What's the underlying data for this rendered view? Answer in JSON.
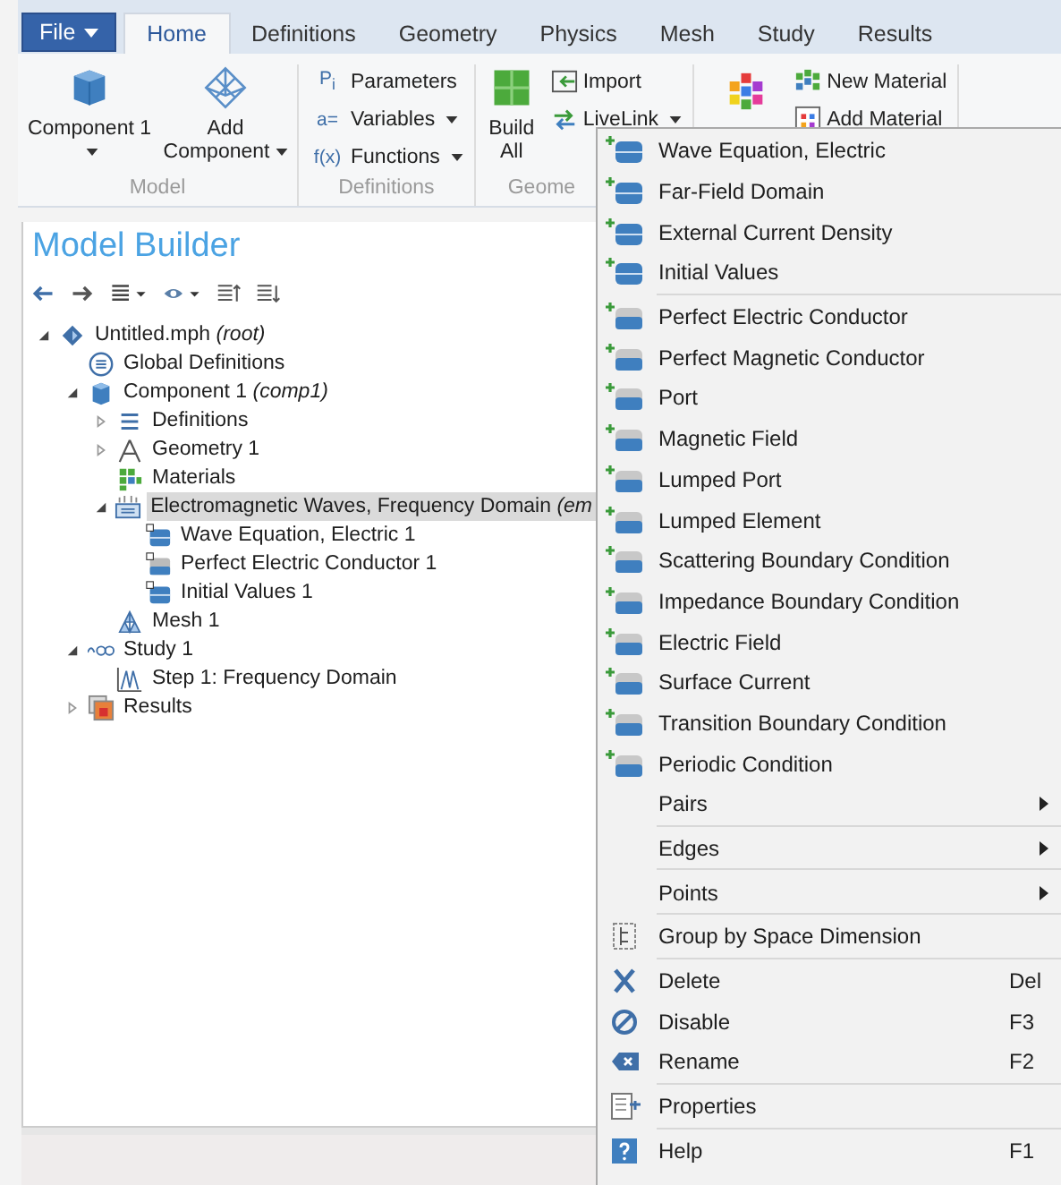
{
  "file_button": {
    "label": "File"
  },
  "tabs": [
    {
      "label": "Home",
      "selected": true
    },
    {
      "label": "Definitions",
      "selected": false
    },
    {
      "label": "Geometry",
      "selected": false
    },
    {
      "label": "Physics",
      "selected": false
    },
    {
      "label": "Mesh",
      "selected": false
    },
    {
      "label": "Study",
      "selected": false
    },
    {
      "label": "Results",
      "selected": false
    }
  ],
  "ribbon": {
    "groups": [
      {
        "label": "Model",
        "large_commands": [
          {
            "label": "Component 1",
            "dropdown": true
          },
          {
            "label": "Add Component",
            "dropdown": true
          }
        ]
      },
      {
        "label": "Definitions",
        "small_commands": [
          {
            "glyph": "P$_{i}$",
            "label": "Parameters",
            "dropdown": false
          },
          {
            "glyph": "a=",
            "label": "Variables",
            "dropdown": true
          },
          {
            "glyph": "f(x)",
            "label": "Functions",
            "dropdown": true
          }
        ]
      },
      {
        "label": "Geome",
        "large_commands": [
          {
            "label": "Build All",
            "dropdown": false
          }
        ],
        "small_commands": [
          {
            "label": "Import",
            "dropdown": false
          },
          {
            "label": "LiveLink",
            "dropdown": true
          }
        ]
      },
      {
        "small_commands": [
          {
            "label": "New Material",
            "dropdown": false
          },
          {
            "label": "Add Material",
            "dropdown": false
          }
        ]
      }
    ]
  },
  "model_builder": {
    "title": "Model Builder",
    "tree": [
      {
        "label": "Untitled.mph *(root)*",
        "kind": "root",
        "expanded": true,
        "selected": false,
        "children": [
          {
            "label": "Global Definitions",
            "kind": "global",
            "selected": false
          },
          {
            "label": "Component 1 *(comp1)*",
            "kind": "component",
            "expanded": true,
            "selected": false,
            "children": [
              {
                "label": "Definitions",
                "kind": "definitions",
                "expanded": false,
                "selected": false
              },
              {
                "label": "Geometry 1",
                "kind": "geometry",
                "expanded": false,
                "selected": false
              },
              {
                "label": "Materials",
                "kind": "materials",
                "selected": false
              },
              {
                "label": "Electromagnetic Waves, Frequency Domain *(em*",
                "kind": "physics",
                "expanded": true,
                "selected": true,
                "children": [
                  {
                    "label": "Wave Equation, Electric 1",
                    "kind": "domain",
                    "selected": false
                  },
                  {
                    "label": "Perfect Electric Conductor 1",
                    "kind": "boundary",
                    "selected": false
                  },
                  {
                    "label": "Initial Values 1",
                    "kind": "domain",
                    "selected": false
                  }
                ]
              },
              {
                "label": "Mesh 1",
                "kind": "mesh",
                "selected": false
              }
            ]
          },
          {
            "label": "Study 1",
            "kind": "study",
            "expanded": true,
            "selected": false,
            "children": [
              {
                "label": "Step 1: Frequency Domain",
                "kind": "step",
                "selected": false
              }
            ]
          },
          {
            "label": "Results",
            "kind": "results",
            "expanded": false,
            "selected": false
          }
        ]
      }
    ]
  },
  "context_menu": {
    "sections": [
      [
        {
          "kind": "domain",
          "label": "Wave Equation, Electric"
        },
        {
          "kind": "domain",
          "label": "Far-Field Domain"
        },
        {
          "kind": "domain",
          "label": "External Current Density"
        },
        {
          "kind": "domain",
          "label": "Initial Values"
        }
      ],
      [
        {
          "kind": "boundary",
          "label": "Perfect Electric Conductor"
        },
        {
          "kind": "boundary",
          "label": "Perfect Magnetic Conductor"
        },
        {
          "kind": "boundary",
          "label": "Port"
        },
        {
          "kind": "boundary",
          "label": "Magnetic Field"
        },
        {
          "kind": "boundary",
          "label": "Lumped Port"
        },
        {
          "kind": "boundary",
          "label": "Lumped Element"
        },
        {
          "kind": "boundary",
          "label": "Scattering Boundary Condition"
        },
        {
          "kind": "boundary",
          "label": "Impedance Boundary Condition"
        },
        {
          "kind": "boundary",
          "label": "Electric Field"
        },
        {
          "kind": "boundary",
          "label": "Surface Current"
        },
        {
          "kind": "boundary",
          "label": "Transition Boundary Condition"
        },
        {
          "kind": "boundary",
          "label": "Periodic Condition"
        },
        {
          "kind": "submenu",
          "label": "Pairs"
        }
      ],
      [
        {
          "kind": "submenu",
          "label": "Edges"
        }
      ],
      [
        {
          "kind": "submenu",
          "label": "Points"
        }
      ],
      [
        {
          "kind": "group",
          "label": "Group by Space Dimension"
        }
      ],
      [
        {
          "kind": "delete",
          "label": "Delete",
          "shortcut": "Del"
        },
        {
          "kind": "disable",
          "label": "Disable",
          "shortcut": "F3"
        },
        {
          "kind": "rename",
          "label": "Rename",
          "shortcut": "F2"
        }
      ],
      [
        {
          "kind": "properties",
          "label": "Properties"
        }
      ],
      [
        {
          "kind": "help",
          "label": "Help",
          "shortcut": "F1"
        }
      ]
    ]
  }
}
